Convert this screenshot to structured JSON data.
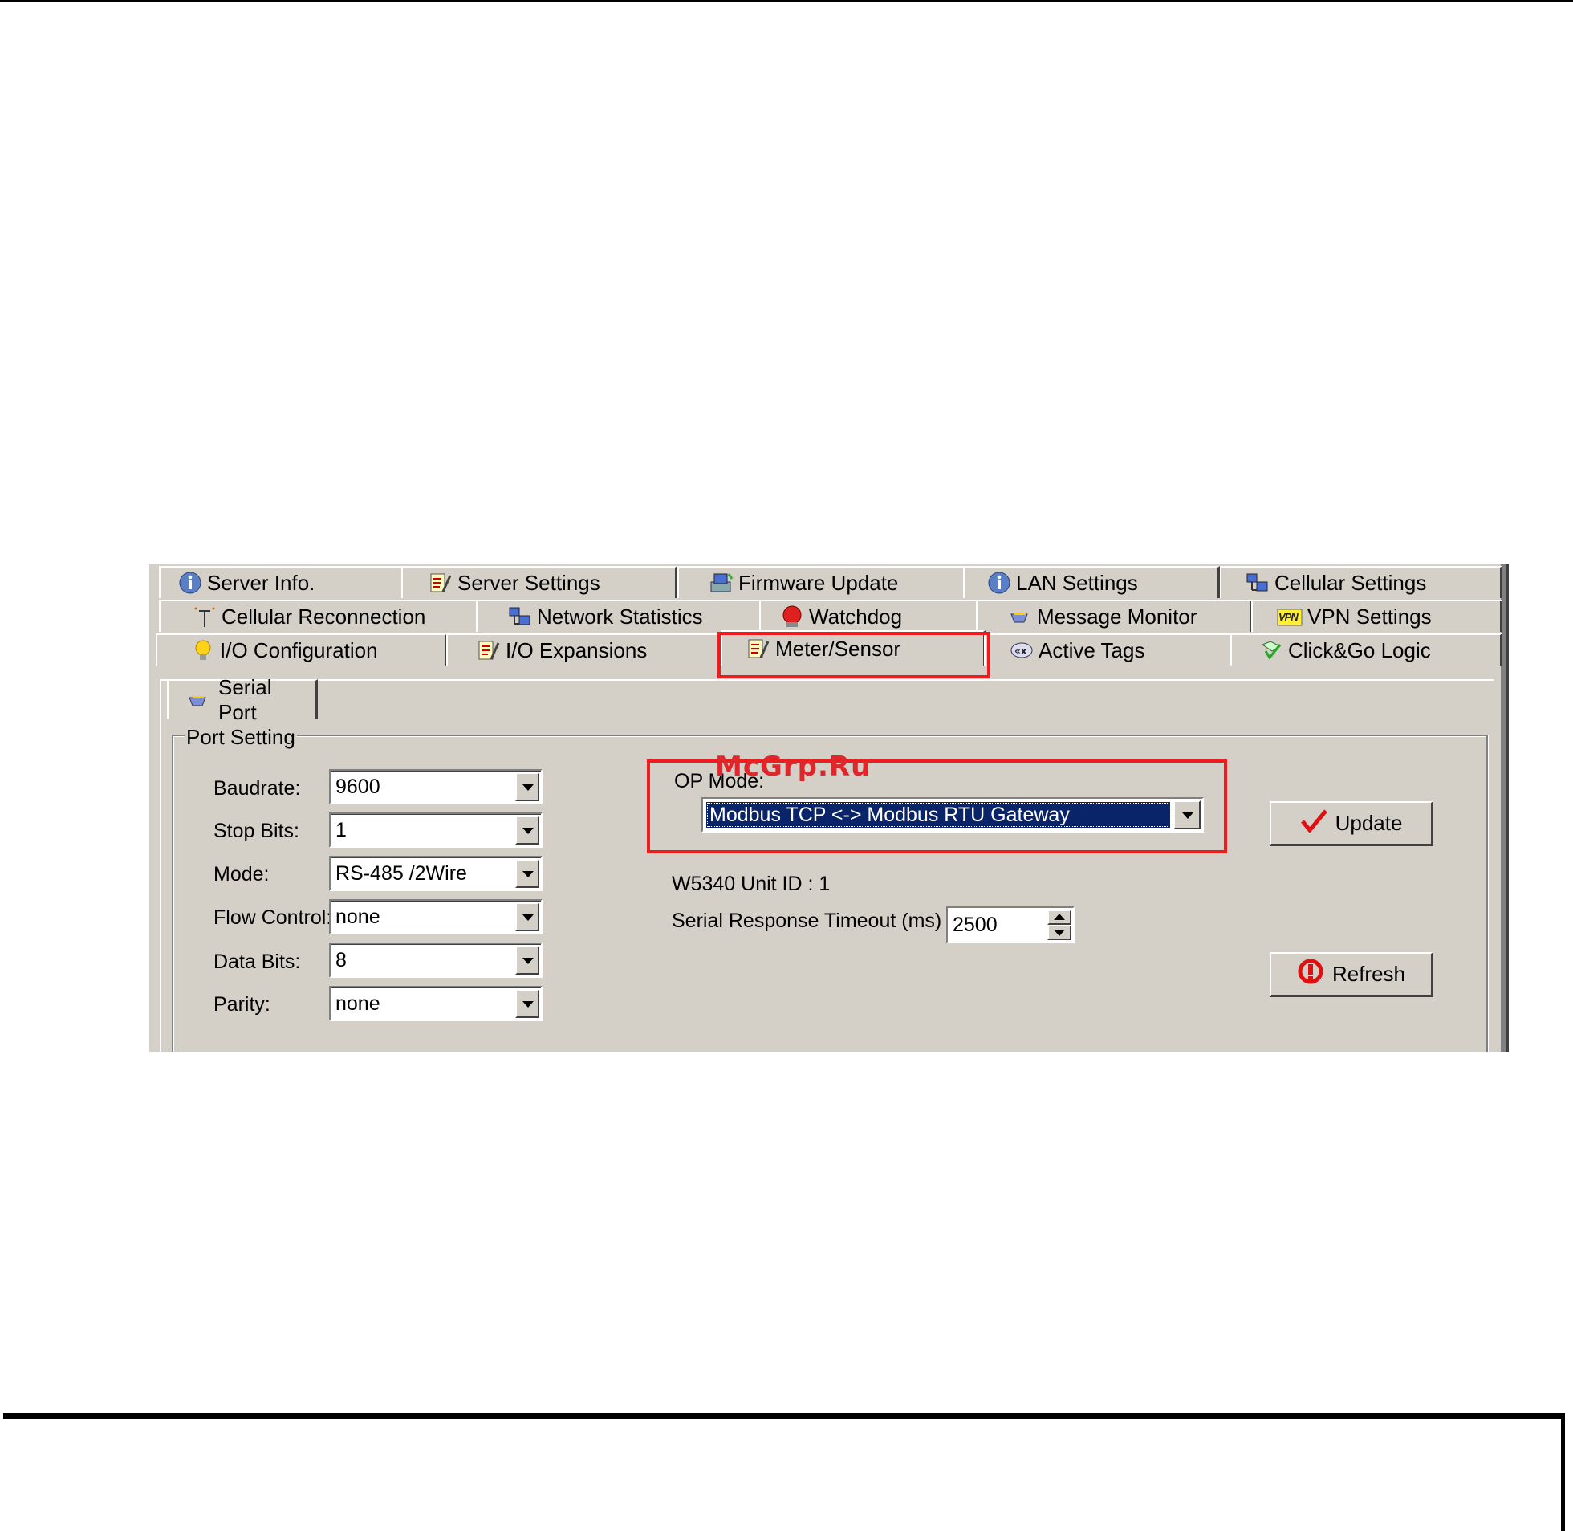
{
  "tabs": {
    "row1": [
      "Server Info.",
      "Server Settings",
      "Firmware Update",
      "LAN Settings",
      "Cellular Settings"
    ],
    "row2": [
      "Cellular Reconnection",
      "Network Statistics",
      "Watchdog",
      "Message Monitor",
      "VPN Settings"
    ],
    "row3": [
      "I/O Configuration",
      "I/O Expansions",
      "Meter/Sensor",
      "Active Tags",
      "Click&Go Logic"
    ],
    "active": "Meter/Sensor"
  },
  "vpn_badge": "VPN",
  "subtab": "Serial Port",
  "group_title": "Port Setting",
  "fields": [
    {
      "label": "Baudrate:",
      "value": "9600"
    },
    {
      "label": "Stop Bits:",
      "value": "1"
    },
    {
      "label": "Mode:",
      "value": "RS-485 /2Wire"
    },
    {
      "label": "Flow Control:",
      "value": "none"
    },
    {
      "label": "Data Bits:",
      "value": "8"
    },
    {
      "label": "Parity:",
      "value": "none"
    }
  ],
  "op_mode": {
    "label": "OP Mode:",
    "value": "Modbus TCP <-> Modbus RTU Gateway"
  },
  "unit_id": "W5340 Unit ID : 1",
  "timeout": {
    "label": "Serial Response Timeout (ms) :",
    "value": "2500"
  },
  "buttons": {
    "update": "Update",
    "refresh": "Refresh"
  },
  "watermark": "McGrp.Ru",
  "colors": {
    "highlight": "#ee1c1c",
    "selection": "#0a246a",
    "face": "#d4d0c8"
  }
}
